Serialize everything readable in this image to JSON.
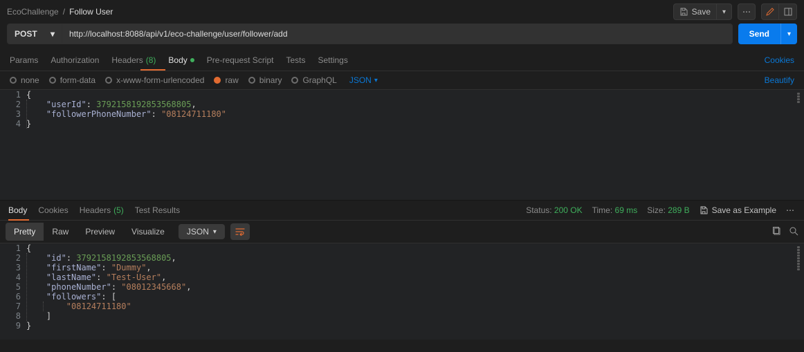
{
  "breadcrumb": {
    "collection": "EcoChallenge",
    "sep": "/",
    "request": "Follow User"
  },
  "top_actions": {
    "save": "Save",
    "save_caret": "▾",
    "more": "…"
  },
  "request": {
    "method": "POST",
    "url": "http://localhost:8088/api/v1/eco-challenge/user/follower/add",
    "send": "Send",
    "tabs": {
      "params": "Params",
      "authorization": "Authorization",
      "headers": {
        "label": "Headers",
        "count": "(8)"
      },
      "body": "Body",
      "prerequest": "Pre-request Script",
      "tests": "Tests",
      "settings": "Settings",
      "cookies_link": "Cookies"
    },
    "body_types": {
      "none": "none",
      "formdata": "form-data",
      "xwww": "x-www-form-urlencoded",
      "raw": "raw",
      "binary": "binary",
      "graphql": "GraphQL",
      "format": "JSON",
      "beautify": "Beautify"
    },
    "body_json": {
      "userId_key": "\"userId\"",
      "userId_val": "3792158192853568805",
      "phone_key": "\"followerPhoneNumber\"",
      "phone_val": "\"08124711180\""
    }
  },
  "response": {
    "tabs": {
      "body": "Body",
      "cookies": "Cookies",
      "headers": {
        "label": "Headers",
        "count": "(5)"
      },
      "tests": "Test Results"
    },
    "meta": {
      "status_lbl": "Status:",
      "status_val": "200 OK",
      "time_lbl": "Time:",
      "time_val": "69 ms",
      "size_lbl": "Size:",
      "size_val": "289 B"
    },
    "save_example": "Save as Example",
    "view": {
      "pretty": "Pretty",
      "raw": "Raw",
      "preview": "Preview",
      "visualize": "Visualize",
      "fmt": "JSON"
    },
    "body_json": {
      "id_key": "\"id\"",
      "id_val": "3792158192853568805",
      "fn_key": "\"firstName\"",
      "fn_val": "\"Dummy\"",
      "ln_key": "\"lastName\"",
      "ln_val": "\"Test-User\"",
      "pn_key": "\"phoneNumber\"",
      "pn_val": "\"08012345668\"",
      "fl_key": "\"followers\"",
      "fl_item": "\"08124711180\""
    }
  },
  "chart_data": {
    "type": "table",
    "data": [
      {
        "section": "request_body",
        "object": {
          "userId": 3792158192853568805,
          "followerPhoneNumber": "08124711180"
        }
      },
      {
        "section": "response_body",
        "object": {
          "id": 3792158192853568805,
          "firstName": "Dummy",
          "lastName": "Test-User",
          "phoneNumber": "08012345668",
          "followers": [
            "08124711180"
          ]
        }
      }
    ]
  }
}
